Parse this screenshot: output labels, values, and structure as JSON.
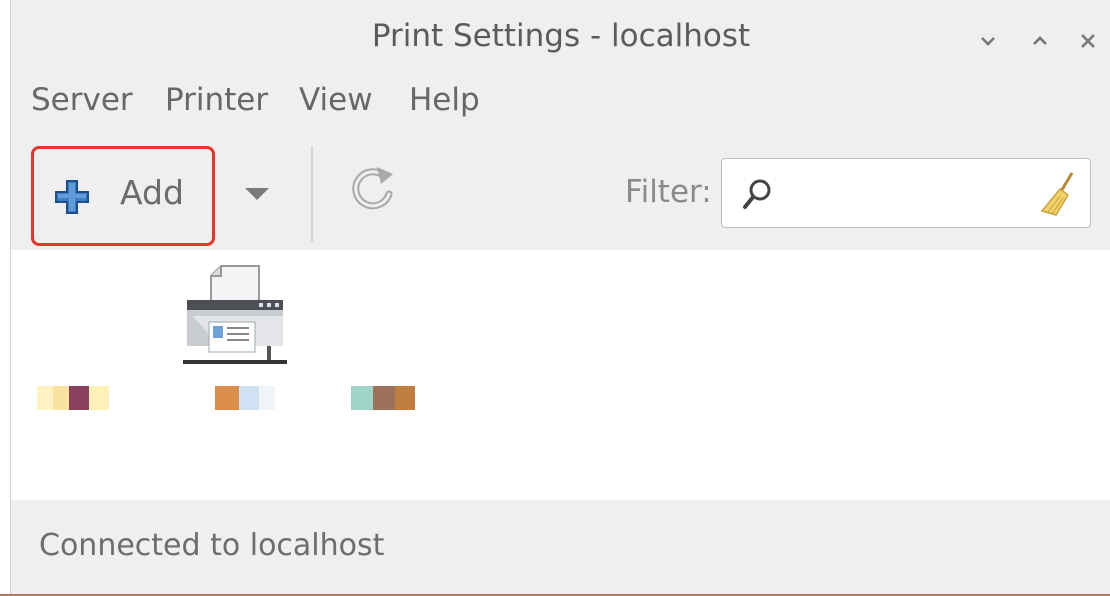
{
  "window": {
    "title": "Print Settings - localhost",
    "controls": [
      "minimize",
      "maximize",
      "close"
    ]
  },
  "menubar": {
    "items": [
      {
        "label": "Server"
      },
      {
        "label": "Printer"
      },
      {
        "label": "View"
      },
      {
        "label": "Help"
      }
    ]
  },
  "toolbar": {
    "add_label": "Add",
    "add_icon": "plus-icon",
    "dropdown_icon": "chevron-down-icon",
    "refresh_icon": "refresh-icon",
    "filter_label": "Filter:",
    "filter_value": "",
    "search_icon": "search-icon",
    "clear_icon": "clear-broom-icon",
    "highlight_color": "#e8352b"
  },
  "printers": [
    {
      "icon": "printer-icon",
      "label_redacted": true
    }
  ],
  "status": {
    "text": "Connected to localhost"
  }
}
